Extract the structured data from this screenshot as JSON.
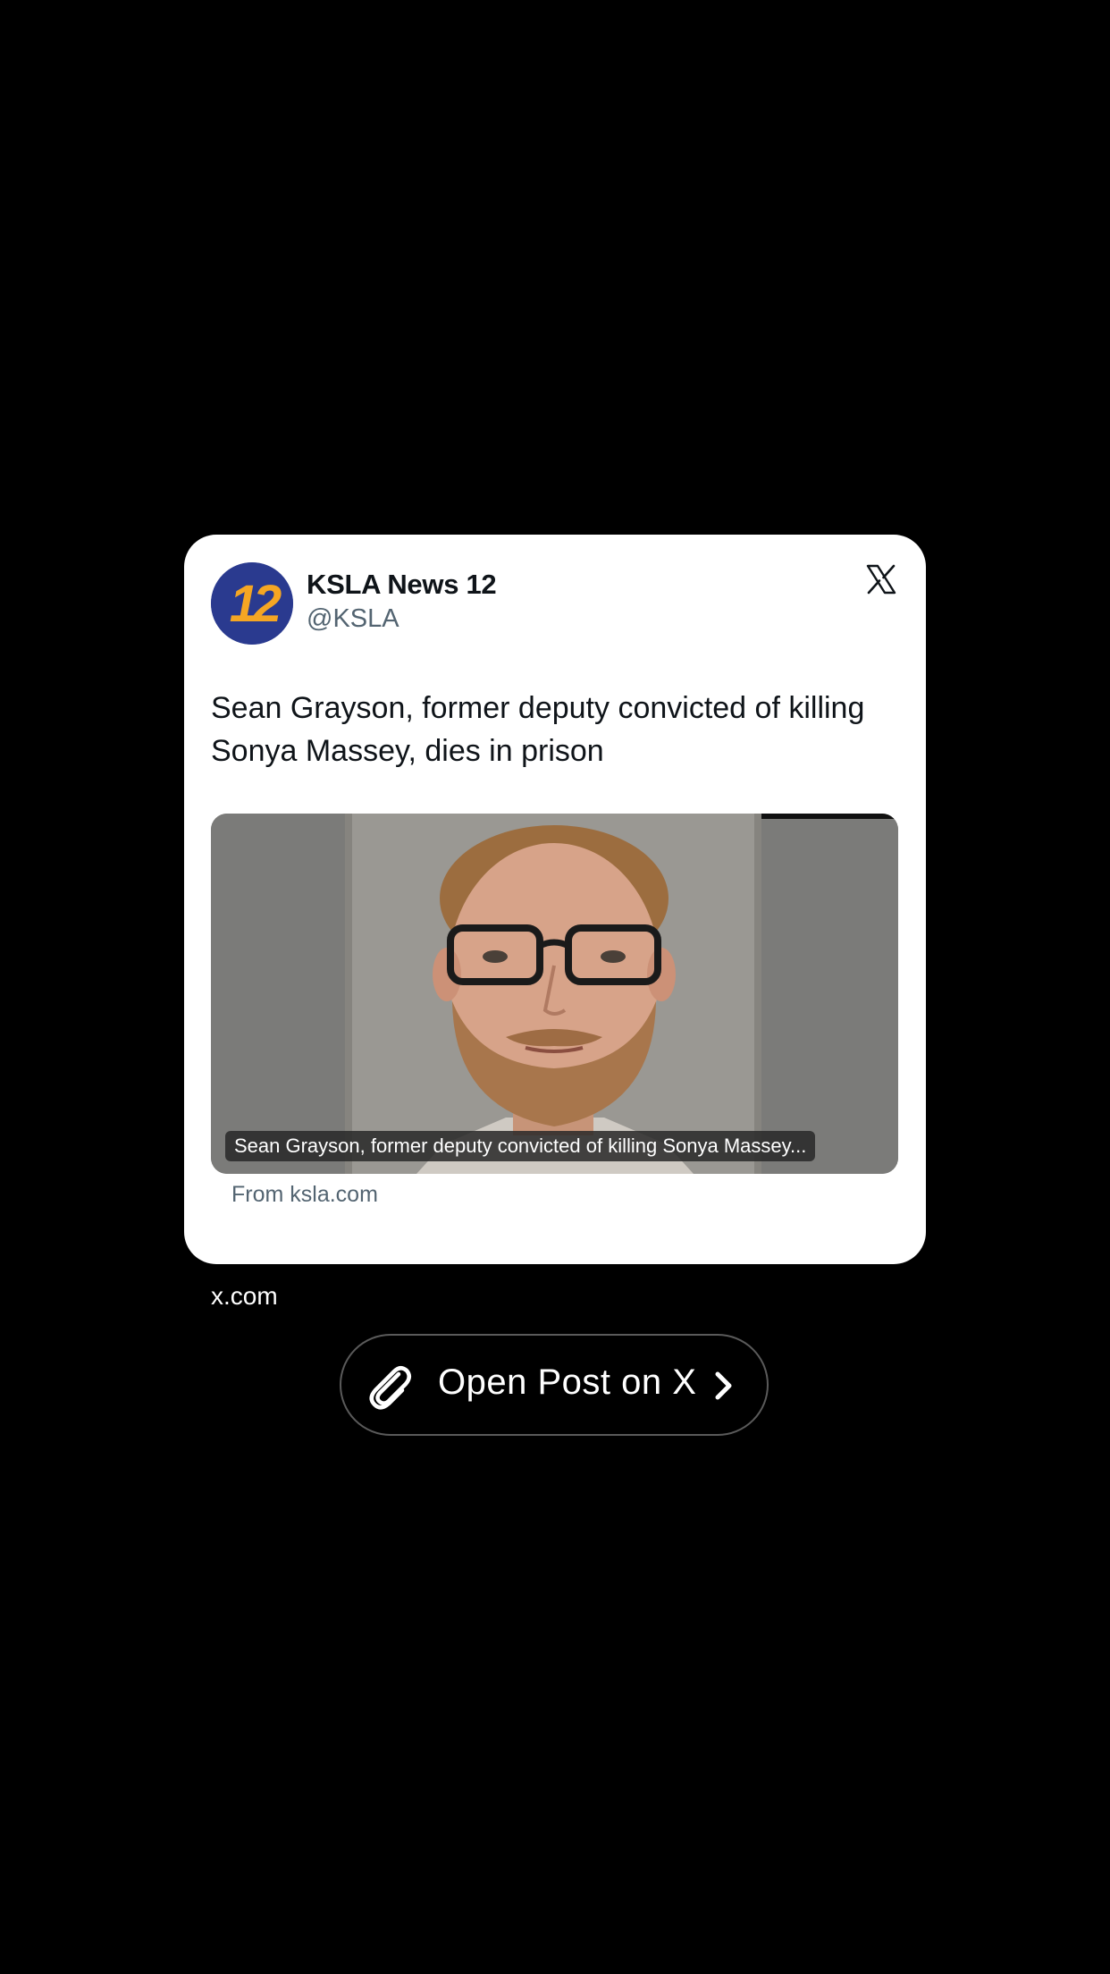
{
  "card": {
    "author_name": "KSLA News 12",
    "author_handle": "@KSLA",
    "avatar_text": "12",
    "post_text": "Sean Grayson, former deputy convicted of killing Sonya Massey, dies in prison",
    "media_caption": "Sean Grayson, former deputy convicted of killing Sonya Massey...",
    "source": "From ksla.com"
  },
  "domain": "x.com",
  "open_button": {
    "label": "Open Post on X"
  },
  "icons": {
    "avatar": "ksla-logo-icon",
    "platform": "x-logo-icon",
    "attachment": "paperclip-icon",
    "chevron": "chevron-right-icon"
  },
  "colors": {
    "background": "#000000",
    "card": "#ffffff",
    "text_primary": "#0f1419",
    "text_secondary": "#536471",
    "avatar_blue": "#2a3a8f",
    "avatar_gold": "#f5a623"
  }
}
